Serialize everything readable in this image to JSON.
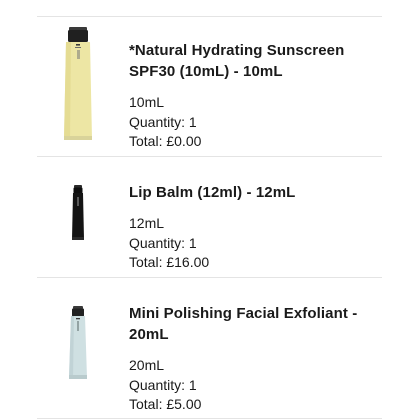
{
  "order_items": [
    {
      "name": "*Natural Hydrating Sunscreen SPF30 (10mL) - 10mL",
      "size": "10mL",
      "quantity": "Quantity: 1",
      "total": "Total: £0.00",
      "thumb_icon": "cream-tube-icon"
    },
    {
      "name": "Lip Balm (12ml) - 12mL",
      "size": "12mL",
      "quantity": "Quantity: 1",
      "total": "Total: £16.00",
      "thumb_icon": "black-tube-icon"
    },
    {
      "name": "Mini Polishing Facial Exfoliant - 20mL",
      "size": "20mL",
      "quantity": "Quantity: 1",
      "total": "Total: £5.00",
      "thumb_icon": "blue-tube-icon"
    }
  ],
  "colors": {
    "text": "#1a1a1a",
    "divider": "#e4e4e4",
    "sunscreen_tube": "#ece6a2",
    "lip_balm_tube": "#141414",
    "exfoliant_tube": "#cfe0e2"
  }
}
